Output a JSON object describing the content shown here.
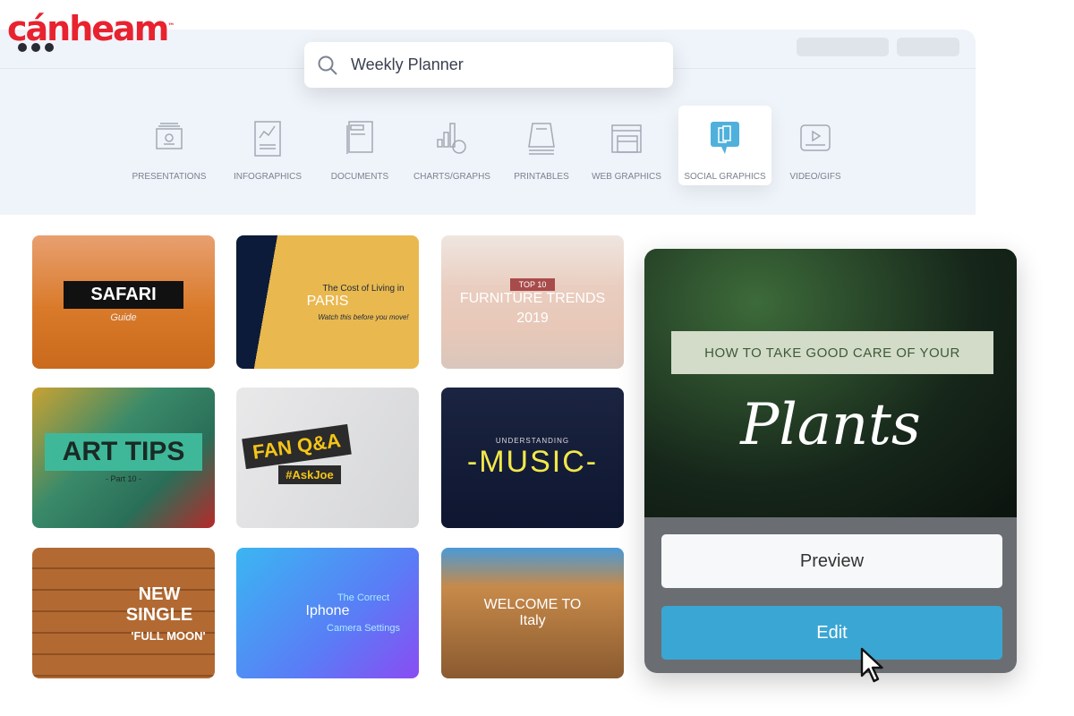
{
  "brand": {
    "logo": "cánheam",
    "tm": "™"
  },
  "search": {
    "value": "Weekly Planner",
    "icon": "search-icon"
  },
  "categories": [
    {
      "label": "PRESENTATIONS",
      "icon": "presentation-icon"
    },
    {
      "label": "INFOGRAPHICS",
      "icon": "infographic-icon"
    },
    {
      "label": "DOCUMENTS",
      "icon": "document-icon"
    },
    {
      "label": "CHARTS/GRAPHS",
      "icon": "chart-icon"
    },
    {
      "label": "PRINTABLES",
      "icon": "printable-icon"
    },
    {
      "label": "WEB GRAPHICS",
      "icon": "web-graphics-icon"
    },
    {
      "label": "SOCIAL GRAPHICS",
      "icon": "social-graphics-icon",
      "active": true
    },
    {
      "label": "VIDEO/GIFS",
      "icon": "video-icon"
    }
  ],
  "accent": "#3aa6d4",
  "templates": [
    {
      "title": "SAFARI",
      "sub": "Guide"
    },
    {
      "pre": "The Cost of Living in",
      "title": "PARIS",
      "sub": "Watch this before you move!"
    },
    {
      "pre": "TOP 10",
      "title": "FURNITURE TRENDS",
      "sub": "2019"
    },
    {
      "title": "ART TIPS",
      "sub": "- Part 10 -"
    },
    {
      "title": "FAN Q&A",
      "sub": "#AskJoe"
    },
    {
      "pre": "UNDERSTANDING",
      "title": "-MUSIC-"
    },
    {
      "title": "NEW SINGLE",
      "sub": "'FULL MOON'"
    },
    {
      "pre": "The Correct",
      "title": "Iphone",
      "sub": "Camera Settings"
    },
    {
      "pre": "WELCOME TO",
      "title": "Italy"
    }
  ],
  "preview_card": {
    "banner": "HOW TO TAKE GOOD CARE OF YOUR",
    "title": "Plants",
    "preview_label": "Preview",
    "edit_label": "Edit"
  }
}
